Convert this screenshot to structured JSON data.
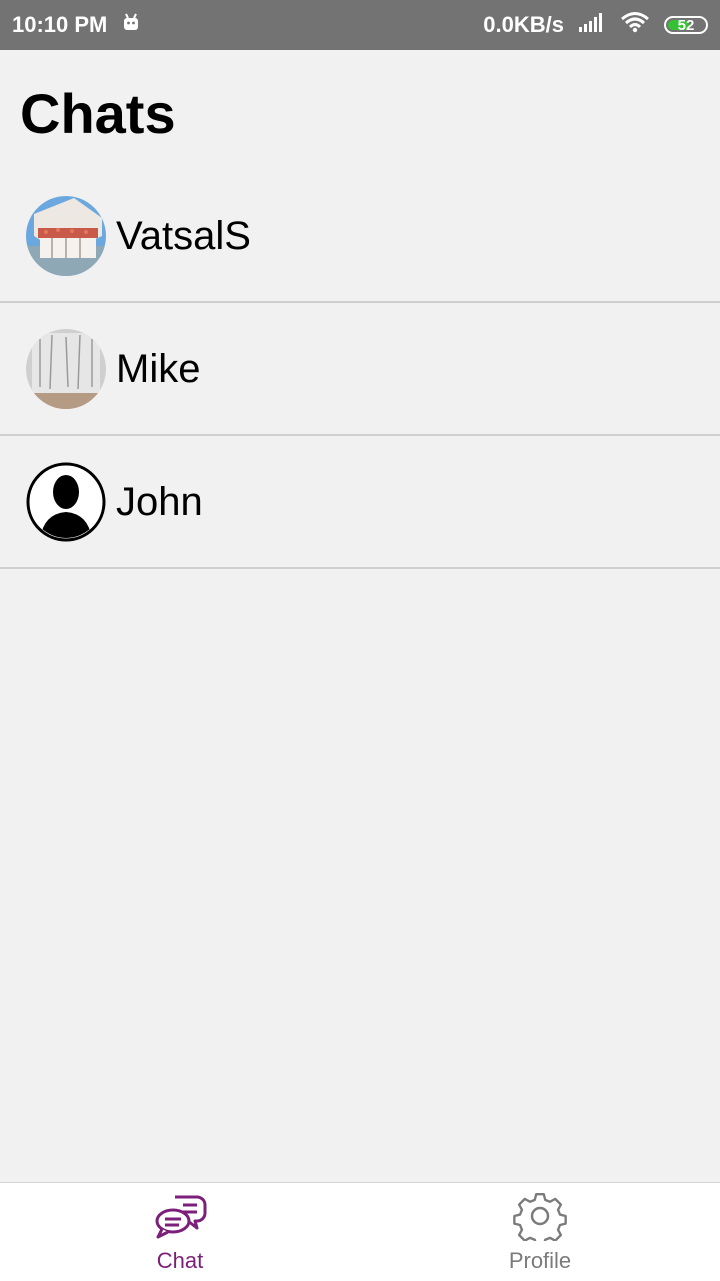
{
  "status_bar": {
    "time": "10:10 PM",
    "network_speed": "0.0KB/s",
    "battery_level": "52",
    "icons": [
      "android-icon",
      "signal-icon",
      "wifi-icon",
      "battery-icon"
    ]
  },
  "page": {
    "title": "Chats"
  },
  "chats": [
    {
      "name": "VatsalS",
      "avatar": "photo-house-avatar"
    },
    {
      "name": "Mike",
      "avatar": "photo-wall-avatar"
    },
    {
      "name": "John",
      "avatar": "default-person-avatar"
    }
  ],
  "bottom_nav": {
    "tabs": [
      {
        "label": "Chat",
        "icon": "chat-bubbles-icon",
        "active": true
      },
      {
        "label": "Profile",
        "icon": "gear-icon",
        "active": false
      }
    ]
  },
  "colors": {
    "accent": "#7c1f7a",
    "status_bar": "#737373",
    "background": "#f1f1f1",
    "divider": "#cfcfcf",
    "battery": "#34c234"
  }
}
